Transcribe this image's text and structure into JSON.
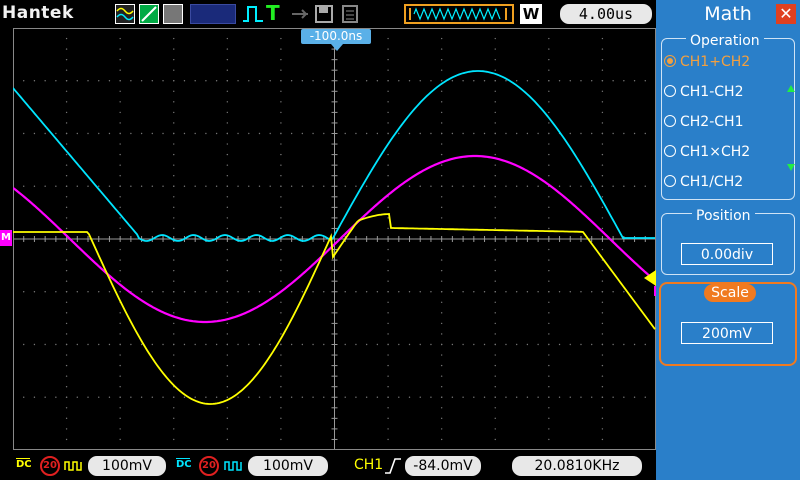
{
  "brand": "Hantek",
  "timebase": "4.00us",
  "acq_mode": "W",
  "trigger_position": "-100.0ns",
  "icons": [
    "waveform-icon",
    "single-icon",
    "persist-icon",
    "pulse-icon",
    "trigger-T-icon",
    "usb-icon",
    "save-icon",
    "print-icon"
  ],
  "channels": [
    {
      "coupling": "DC",
      "bw_limit": "20",
      "scale": "100mV",
      "color": "#ffff00"
    },
    {
      "coupling": "DC",
      "bw_limit": "20",
      "scale": "100mV",
      "color": "#00e5ff"
    }
  ],
  "trigger": {
    "source": "CH1",
    "level": "-84.0mV"
  },
  "frequency": "20.0810KHz",
  "math_color": "#ff00ff",
  "math_marker": "M",
  "panel": {
    "title": "Math",
    "operation_label": "Operation",
    "operations": [
      "CH1+CH2",
      "CH1-CH2",
      "CH2-CH1",
      "CH1×CH2",
      "CH1/CH2"
    ],
    "selected_operation": "CH1+CH2",
    "position_label": "Position",
    "position_value": "0.00div",
    "scale_label": "Scale",
    "scale_value": "200mV"
  }
}
